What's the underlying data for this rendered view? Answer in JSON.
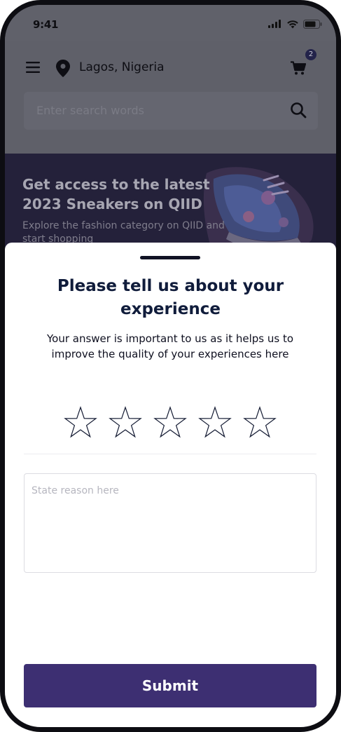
{
  "status_bar": {
    "time": "9:41"
  },
  "header": {
    "location": "Lagos, Nigeria",
    "cart_count": "2",
    "search_placeholder": "Enter search words"
  },
  "banner": {
    "title": "Get access to the latest 2023 Sneakers on QIID",
    "subtitle": "Explore the fashion category on QIID and start shopping"
  },
  "feedback_sheet": {
    "title": "Please tell us about your experience",
    "description": "Your answer is important to us as it helps us to improve the quality of your experiences here",
    "rating": {
      "max": 5,
      "selected": 0
    },
    "reason_placeholder": "State reason here",
    "submit_label": "Submit"
  },
  "colors": {
    "primary": "#3d2f72",
    "title_text": "#101c3b",
    "overlay_dim": "#5f6069",
    "banner_bg": "#24213a"
  },
  "icons": [
    "menu-icon",
    "location-pin-icon",
    "cart-icon",
    "search-icon",
    "star-outline-icon",
    "signal-icon",
    "wifi-icon",
    "battery-icon"
  ]
}
